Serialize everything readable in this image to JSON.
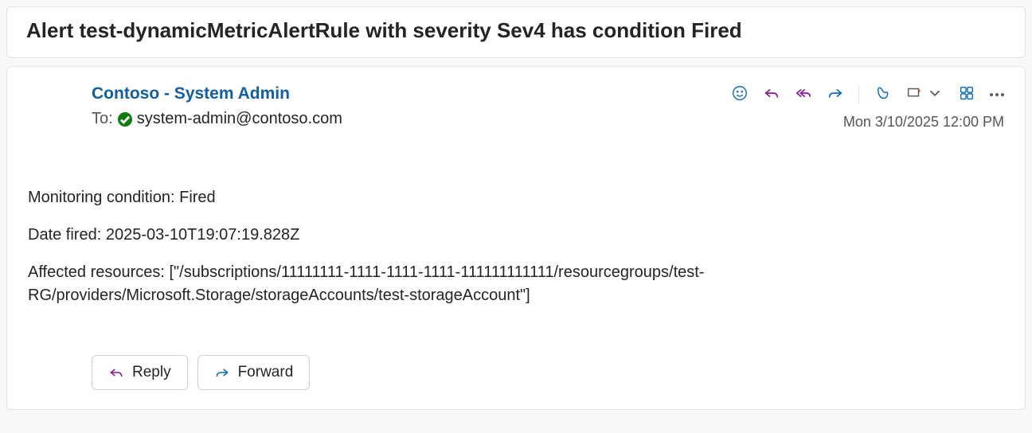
{
  "subject": "Alert test-dynamicMetricAlertRule with severity Sev4 has condition Fired",
  "sender": "Contoso - System Admin",
  "to_label": "To:",
  "recipient": "system-admin@contoso.com",
  "timestamp": "Mon 3/10/2025 12:00 PM",
  "body": {
    "line1": "Monitoring condition: Fired",
    "line2": "Date fired: 2025-03-10T19:07:19.828Z",
    "line3": "Affected resources: [\"/subscriptions/11111111-1111-1111-1111-111111111111/resourcegroups/test-RG/providers/Microsoft.Storage/storageAccounts/test-storageAccount\"]"
  },
  "actions": {
    "reply": "Reply",
    "forward": "Forward"
  }
}
